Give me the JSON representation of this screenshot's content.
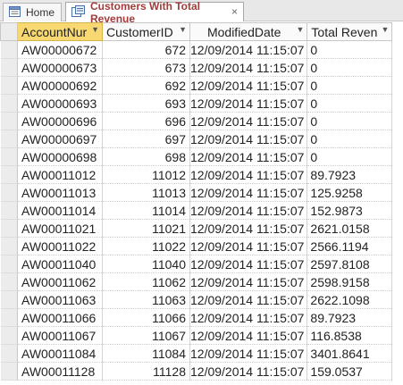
{
  "tabs": [
    {
      "label": "Home",
      "icon": "form-icon"
    },
    {
      "label": "Customers With Total Revenue",
      "icon": "query-icon"
    }
  ],
  "close_glyph": "×",
  "columns": [
    {
      "label": "AccountNur"
    },
    {
      "label": "CustomerID"
    },
    {
      "label": "ModifiedDate"
    },
    {
      "label": "Total Reven"
    }
  ],
  "dropdown_glyph": "▼",
  "rows": [
    {
      "account": "AW00000672",
      "customer_id": "672",
      "modified": "12/09/2014 11:15:07",
      "revenue": "0"
    },
    {
      "account": "AW00000673",
      "customer_id": "673",
      "modified": "12/09/2014 11:15:07",
      "revenue": "0"
    },
    {
      "account": "AW00000692",
      "customer_id": "692",
      "modified": "12/09/2014 11:15:07",
      "revenue": "0"
    },
    {
      "account": "AW00000693",
      "customer_id": "693",
      "modified": "12/09/2014 11:15:07",
      "revenue": "0"
    },
    {
      "account": "AW00000696",
      "customer_id": "696",
      "modified": "12/09/2014 11:15:07",
      "revenue": "0"
    },
    {
      "account": "AW00000697",
      "customer_id": "697",
      "modified": "12/09/2014 11:15:07",
      "revenue": "0"
    },
    {
      "account": "AW00000698",
      "customer_id": "698",
      "modified": "12/09/2014 11:15:07",
      "revenue": "0"
    },
    {
      "account": "AW00011012",
      "customer_id": "11012",
      "modified": "12/09/2014 11:15:07",
      "revenue": "89.7923"
    },
    {
      "account": "AW00011013",
      "customer_id": "11013",
      "modified": "12/09/2014 11:15:07",
      "revenue": "125.9258"
    },
    {
      "account": "AW00011014",
      "customer_id": "11014",
      "modified": "12/09/2014 11:15:07",
      "revenue": "152.9873"
    },
    {
      "account": "AW00011021",
      "customer_id": "11021",
      "modified": "12/09/2014 11:15:07",
      "revenue": "2621.0158"
    },
    {
      "account": "AW00011022",
      "customer_id": "11022",
      "modified": "12/09/2014 11:15:07",
      "revenue": "2566.1194"
    },
    {
      "account": "AW00011040",
      "customer_id": "11040",
      "modified": "12/09/2014 11:15:07",
      "revenue": "2597.8108"
    },
    {
      "account": "AW00011062",
      "customer_id": "11062",
      "modified": "12/09/2014 11:15:07",
      "revenue": "2598.9158"
    },
    {
      "account": "AW00011063",
      "customer_id": "11063",
      "modified": "12/09/2014 11:15:07",
      "revenue": "2622.1098"
    },
    {
      "account": "AW00011066",
      "customer_id": "11066",
      "modified": "12/09/2014 11:15:07",
      "revenue": "89.7923"
    },
    {
      "account": "AW00011067",
      "customer_id": "11067",
      "modified": "12/09/2014 11:15:07",
      "revenue": "116.8538"
    },
    {
      "account": "AW00011084",
      "customer_id": "11084",
      "modified": "12/09/2014 11:15:07",
      "revenue": "3401.8641"
    },
    {
      "account": "AW00011128",
      "customer_id": "11128",
      "modified": "12/09/2014 11:15:07",
      "revenue": "159.0537"
    }
  ],
  "colors": {
    "selected_header": "#f7d871",
    "active_tab_text": "#a33b3b"
  }
}
